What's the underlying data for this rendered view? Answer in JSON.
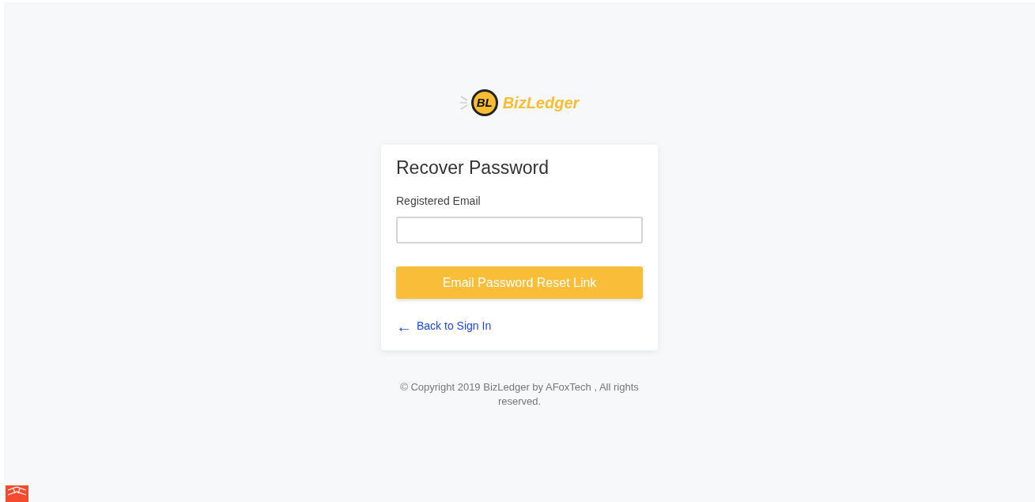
{
  "logo": {
    "mark": "BL",
    "name": "BizLedger"
  },
  "card": {
    "title": "Recover Password",
    "field": {
      "label": "Registered Email"
    },
    "button": "Email Password Reset Link",
    "back_link": {
      "icon": "←",
      "label": "Back to Sign In"
    }
  },
  "footer": "© Copyright 2019 BizLedger by AFoxTech , All rights reserved."
}
